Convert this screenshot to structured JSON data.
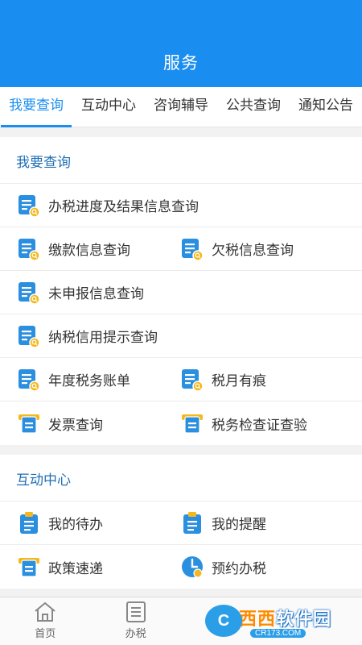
{
  "header": {
    "title": "服务"
  },
  "tabs": [
    {
      "label": "我要查询",
      "active": true
    },
    {
      "label": "互动中心",
      "active": false
    },
    {
      "label": "咨询辅导",
      "active": false
    },
    {
      "label": "公共查询",
      "active": false
    },
    {
      "label": "通知公告",
      "active": false
    }
  ],
  "sections": {
    "query": {
      "title": "我要查询",
      "items": [
        "办税进度及结果信息查询",
        "缴款信息查询",
        "欠税信息查询",
        "未申报信息查询",
        "纳税信用提示查询",
        "年度税务账单",
        "税月有痕",
        "发票查询",
        "税务检查证查验"
      ]
    },
    "interact": {
      "title": "互动中心",
      "items": [
        "我的待办",
        "我的提醒",
        "政策速递",
        "预约办税"
      ]
    }
  },
  "bottom_nav": [
    {
      "label": "首页",
      "icon": "home-icon"
    },
    {
      "label": "办税",
      "icon": "list-icon"
    }
  ],
  "watermark": {
    "main_a": "西西",
    "main_b": "软件园",
    "sub": "CR173.COM",
    "logo": "C"
  },
  "colors": {
    "primary": "#1a8ef0",
    "section_title": "#1f6fb5",
    "icon_blue": "#2b8fe0",
    "icon_yellow": "#f5b81c"
  }
}
